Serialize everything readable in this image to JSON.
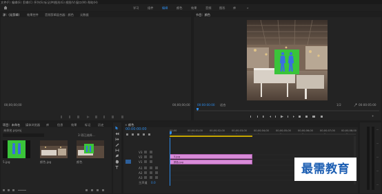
{
  "menu": [
    "文件(F)",
    "编辑(E)",
    "剪辑(C)",
    "序列(S)",
    "标记(M)",
    "图形(G)",
    "视图(V)",
    "窗口(W)",
    "帮助(H)"
  ],
  "workspaces": [
    "学习",
    "组件",
    "编辑",
    "颜色",
    "效果",
    "音频",
    "图形",
    "库"
  ],
  "source_tabs": [
    "源：(无剪辑)",
    "效果控件",
    "音频剪辑混合器：颜色",
    "元数据"
  ],
  "source_timecode_left": "00;00;00;00",
  "source_timecode_right": "00;00;00;00",
  "program": {
    "title": "节目：颜色",
    "timecode_left": "00:00:00:00",
    "fit": "适合",
    "fraction": "1/2",
    "timecode_right": "00:00:05:00"
  },
  "project": {
    "tabs": [
      "项目：未命名",
      "媒体浏览器",
      "库",
      "信息",
      "效果",
      "标记",
      "历史"
    ],
    "filename": "未命名.prproj",
    "item_count": "3 项已选择…",
    "items": [
      {
        "name": "5.jpg",
        "duration": "5;00"
      },
      {
        "name": "颜色.jpg",
        "duration": "5;00"
      },
      {
        "name": "颜色",
        "duration": "5;00"
      }
    ]
  },
  "timeline": {
    "title": "颜色",
    "timecode": "00:00:00:00",
    "ruler": [
      "00;00",
      "00;00;01;00",
      "00;00;02;00",
      "00;00;03;00",
      "00;00;04;00",
      "00;00;05;00",
      "00;00;06;00",
      "00;00;07;00",
      "00;00;08;00"
    ],
    "video_tracks": [
      "V3",
      "V2",
      "V1"
    ],
    "audio_tracks": [
      "A1",
      "A2",
      "A3"
    ],
    "master": "主声道",
    "master_value": "0.0",
    "clips": [
      {
        "label": "5.jpg",
        "color": "#d88bd8"
      },
      {
        "label": "颜色.jpg",
        "color": "#d88bd8"
      }
    ]
  },
  "watermark": "最需教育",
  "colors": {
    "accent": "#2d8ceb",
    "clip": "#d88bd8",
    "green": "#3ac43a"
  }
}
